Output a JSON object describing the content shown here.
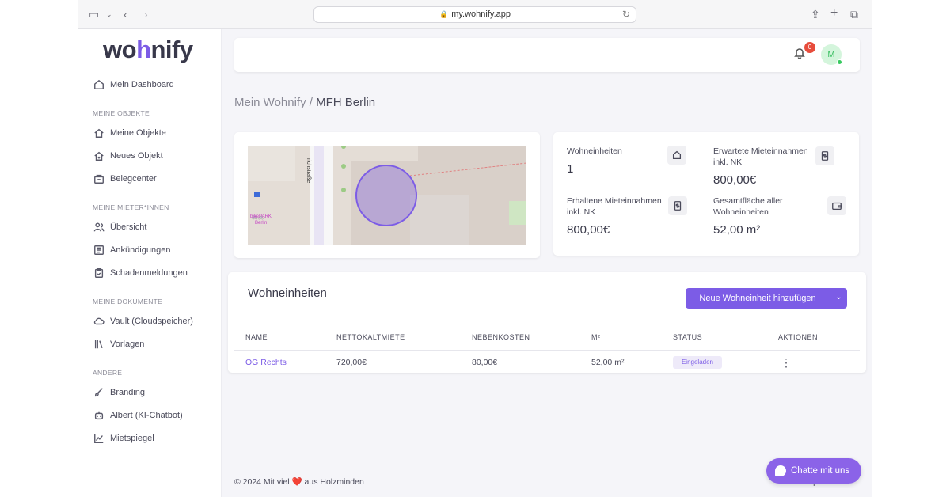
{
  "browser": {
    "url": "my.wohnify.app"
  },
  "logo": {
    "before": "wo",
    "accent": "h",
    "after": "nify"
  },
  "sidebar": {
    "dashboard": "Mein Dashboard",
    "sections": [
      {
        "heading": "MEINE OBJEKTE",
        "items": [
          "Meine Objekte",
          "Neues Objekt",
          "Belegcenter"
        ]
      },
      {
        "heading": "MEINE MIETER*INNEN",
        "items": [
          "Übersicht",
          "Ankündigungen",
          "Schadenmeldungen"
        ]
      },
      {
        "heading": "MEINE DOKUMENTE",
        "items": [
          "Vault (Cloudspeicher)",
          "Vorlagen"
        ]
      },
      {
        "heading": "ANDERE",
        "items": [
          "Branding",
          "Albert (KI-Chatbot)",
          "Mietspiegel"
        ]
      }
    ]
  },
  "topbar": {
    "notification_count": "0",
    "avatar_initial": "M"
  },
  "breadcrumb": {
    "parent": "Mein Wohnify /",
    "current": "MFH Berlin"
  },
  "map": {
    "street": "richstraße",
    "poi_label": "bikePARK",
    "poi_city": "Berlin"
  },
  "stats": {
    "units_label": "Wohneinheiten",
    "units_value": "1",
    "expected_label": "Erwartete Mieteinnahmen inkl. NK",
    "expected_value": "800,00€",
    "received_label": "Erhaltene Mieteinnahmen inkl. NK",
    "received_value": "800,00€",
    "area_label": "Gesamtfläche aller Wohneinheiten",
    "area_value": "52,00 m²"
  },
  "table": {
    "title": "Wohneinheiten",
    "add_button": "Neue Wohneinheit hinzufügen",
    "columns": [
      "NAME",
      "NETTOKALTMIETE",
      "NEBENKOSTEN",
      "M²",
      "STATUS",
      "AKTIONEN"
    ],
    "rows": [
      {
        "name": "OG Rechts",
        "rent": "720,00€",
        "costs": "80,00€",
        "area": "52,00 m²",
        "status": "Eingeladen"
      }
    ]
  },
  "footer": {
    "prefix": "© 2024 Mit viel",
    "suffix": "aus Holzminden",
    "impressum": "Impressum"
  },
  "chat": {
    "label": "Chatte mit uns"
  },
  "colors": {
    "accent": "#7c5ce6",
    "badge": "#e74c3c",
    "online": "#37c95f"
  }
}
